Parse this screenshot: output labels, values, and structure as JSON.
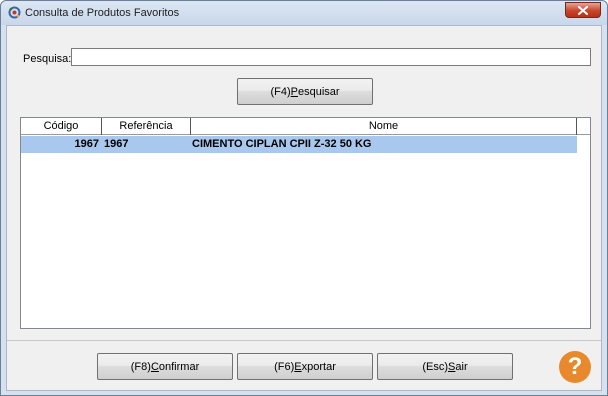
{
  "window": {
    "title": "Consulta de Produtos Favoritos"
  },
  "search": {
    "label": "Pesquisa:",
    "value": "",
    "placeholder": ""
  },
  "buttons": {
    "search_prefix": "(F4) ",
    "search_accel": "P",
    "search_rest": "esquisar",
    "confirm_prefix": "(F8) ",
    "confirm_accel": "C",
    "confirm_rest": "onfirmar",
    "export_prefix": "(F6) ",
    "export_accel": "E",
    "export_rest": "xportar",
    "exit_prefix": "(Esc) ",
    "exit_accel": "S",
    "exit_rest": "air"
  },
  "grid": {
    "columns": [
      "Código",
      "Referência",
      "Nome"
    ],
    "rows": [
      {
        "codigo": "1967",
        "referencia": "1967",
        "nome": "CIMENTO CIPLAN CPII Z-32 50 KG"
      }
    ],
    "selected_row_color": "#a9c8ee"
  },
  "help": {
    "icon": "help-icon",
    "glyph": "?"
  },
  "colors": {
    "close_button": "#c7462b",
    "help_icon": "#e8892d"
  }
}
